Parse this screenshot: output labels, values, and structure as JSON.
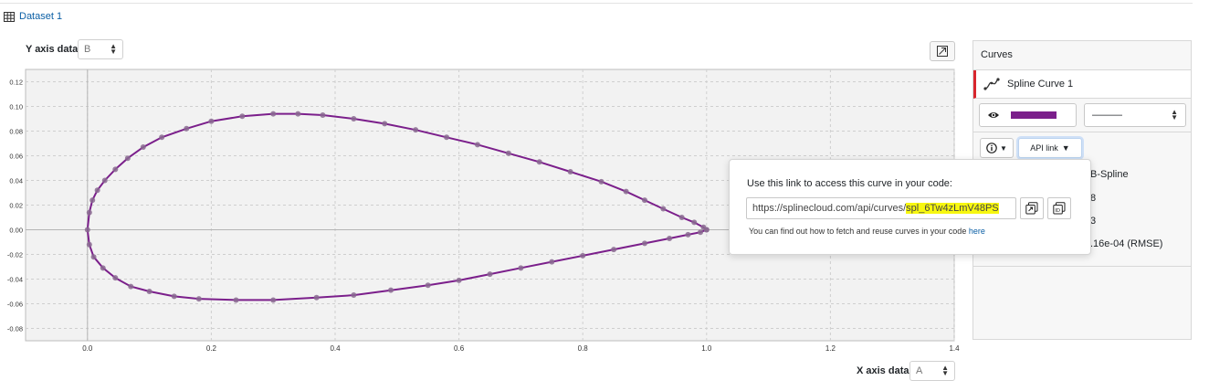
{
  "dataset": {
    "label": "Dataset 1"
  },
  "y_axis_select": {
    "label": "Y axis data:",
    "value": "B"
  },
  "x_axis_select": {
    "label": "X axis data:",
    "value": "A"
  },
  "curves_panel": {
    "header": "Curves",
    "curve_name": "Spline Curve 1",
    "line_style": "———",
    "api_button": "API link",
    "info_values": [
      "B-Spline",
      "8",
      "3",
      ".16e-04 (RMSE)"
    ],
    "curve_color": "#7b1f8b"
  },
  "popover": {
    "title": "Use this link to access this curve in your code:",
    "url_prefix": "https://splinecloud.com/api/curves/",
    "url_id": "spl_6Tw4zLmV48PS",
    "note": "You can find out how to fetch and reuse curves in your code",
    "note_link": "here"
  },
  "chart_data": {
    "type": "line",
    "xlim": [
      -0.1,
      1.4
    ],
    "ylim": [
      -0.09,
      0.13
    ],
    "xticks": [
      0.0,
      0.2,
      0.4,
      0.6,
      0.8,
      1.0,
      1.2,
      1.4
    ],
    "yticks": [
      -0.08,
      -0.06,
      -0.04,
      -0.02,
      0.0,
      0.02,
      0.04,
      0.06,
      0.08,
      0.1,
      0.12
    ],
    "grid": true,
    "series": [
      {
        "color": "#7b1f8b",
        "points": [
          [
            1.0,
            0.0
          ],
          [
            0.995,
            0.002
          ],
          [
            0.98,
            0.006
          ],
          [
            0.96,
            0.01
          ],
          [
            0.93,
            0.017
          ],
          [
            0.9,
            0.024
          ],
          [
            0.87,
            0.031
          ],
          [
            0.83,
            0.039
          ],
          [
            0.78,
            0.047
          ],
          [
            0.73,
            0.055
          ],
          [
            0.68,
            0.062
          ],
          [
            0.63,
            0.069
          ],
          [
            0.58,
            0.075
          ],
          [
            0.53,
            0.081
          ],
          [
            0.48,
            0.086
          ],
          [
            0.43,
            0.09
          ],
          [
            0.38,
            0.093
          ],
          [
            0.34,
            0.094
          ],
          [
            0.3,
            0.094
          ],
          [
            0.25,
            0.092
          ],
          [
            0.2,
            0.088
          ],
          [
            0.16,
            0.082
          ],
          [
            0.12,
            0.075
          ],
          [
            0.09,
            0.067
          ],
          [
            0.065,
            0.058
          ],
          [
            0.045,
            0.049
          ],
          [
            0.028,
            0.04
          ],
          [
            0.016,
            0.032
          ],
          [
            0.008,
            0.024
          ],
          [
            0.003,
            0.014
          ],
          [
            0.0,
            0.0
          ],
          [
            0.003,
            -0.012
          ],
          [
            0.01,
            -0.022
          ],
          [
            0.025,
            -0.031
          ],
          [
            0.045,
            -0.039
          ],
          [
            0.07,
            -0.046
          ],
          [
            0.1,
            -0.05
          ],
          [
            0.14,
            -0.054
          ],
          [
            0.18,
            -0.056
          ],
          [
            0.24,
            -0.057
          ],
          [
            0.3,
            -0.057
          ],
          [
            0.37,
            -0.055
          ],
          [
            0.43,
            -0.053
          ],
          [
            0.49,
            -0.049
          ],
          [
            0.55,
            -0.045
          ],
          [
            0.6,
            -0.041
          ],
          [
            0.65,
            -0.036
          ],
          [
            0.7,
            -0.031
          ],
          [
            0.75,
            -0.026
          ],
          [
            0.8,
            -0.021
          ],
          [
            0.85,
            -0.016
          ],
          [
            0.9,
            -0.011
          ],
          [
            0.94,
            -0.007
          ],
          [
            0.97,
            -0.004
          ],
          [
            0.99,
            -0.002
          ],
          [
            1.0,
            0.0
          ]
        ]
      }
    ]
  }
}
